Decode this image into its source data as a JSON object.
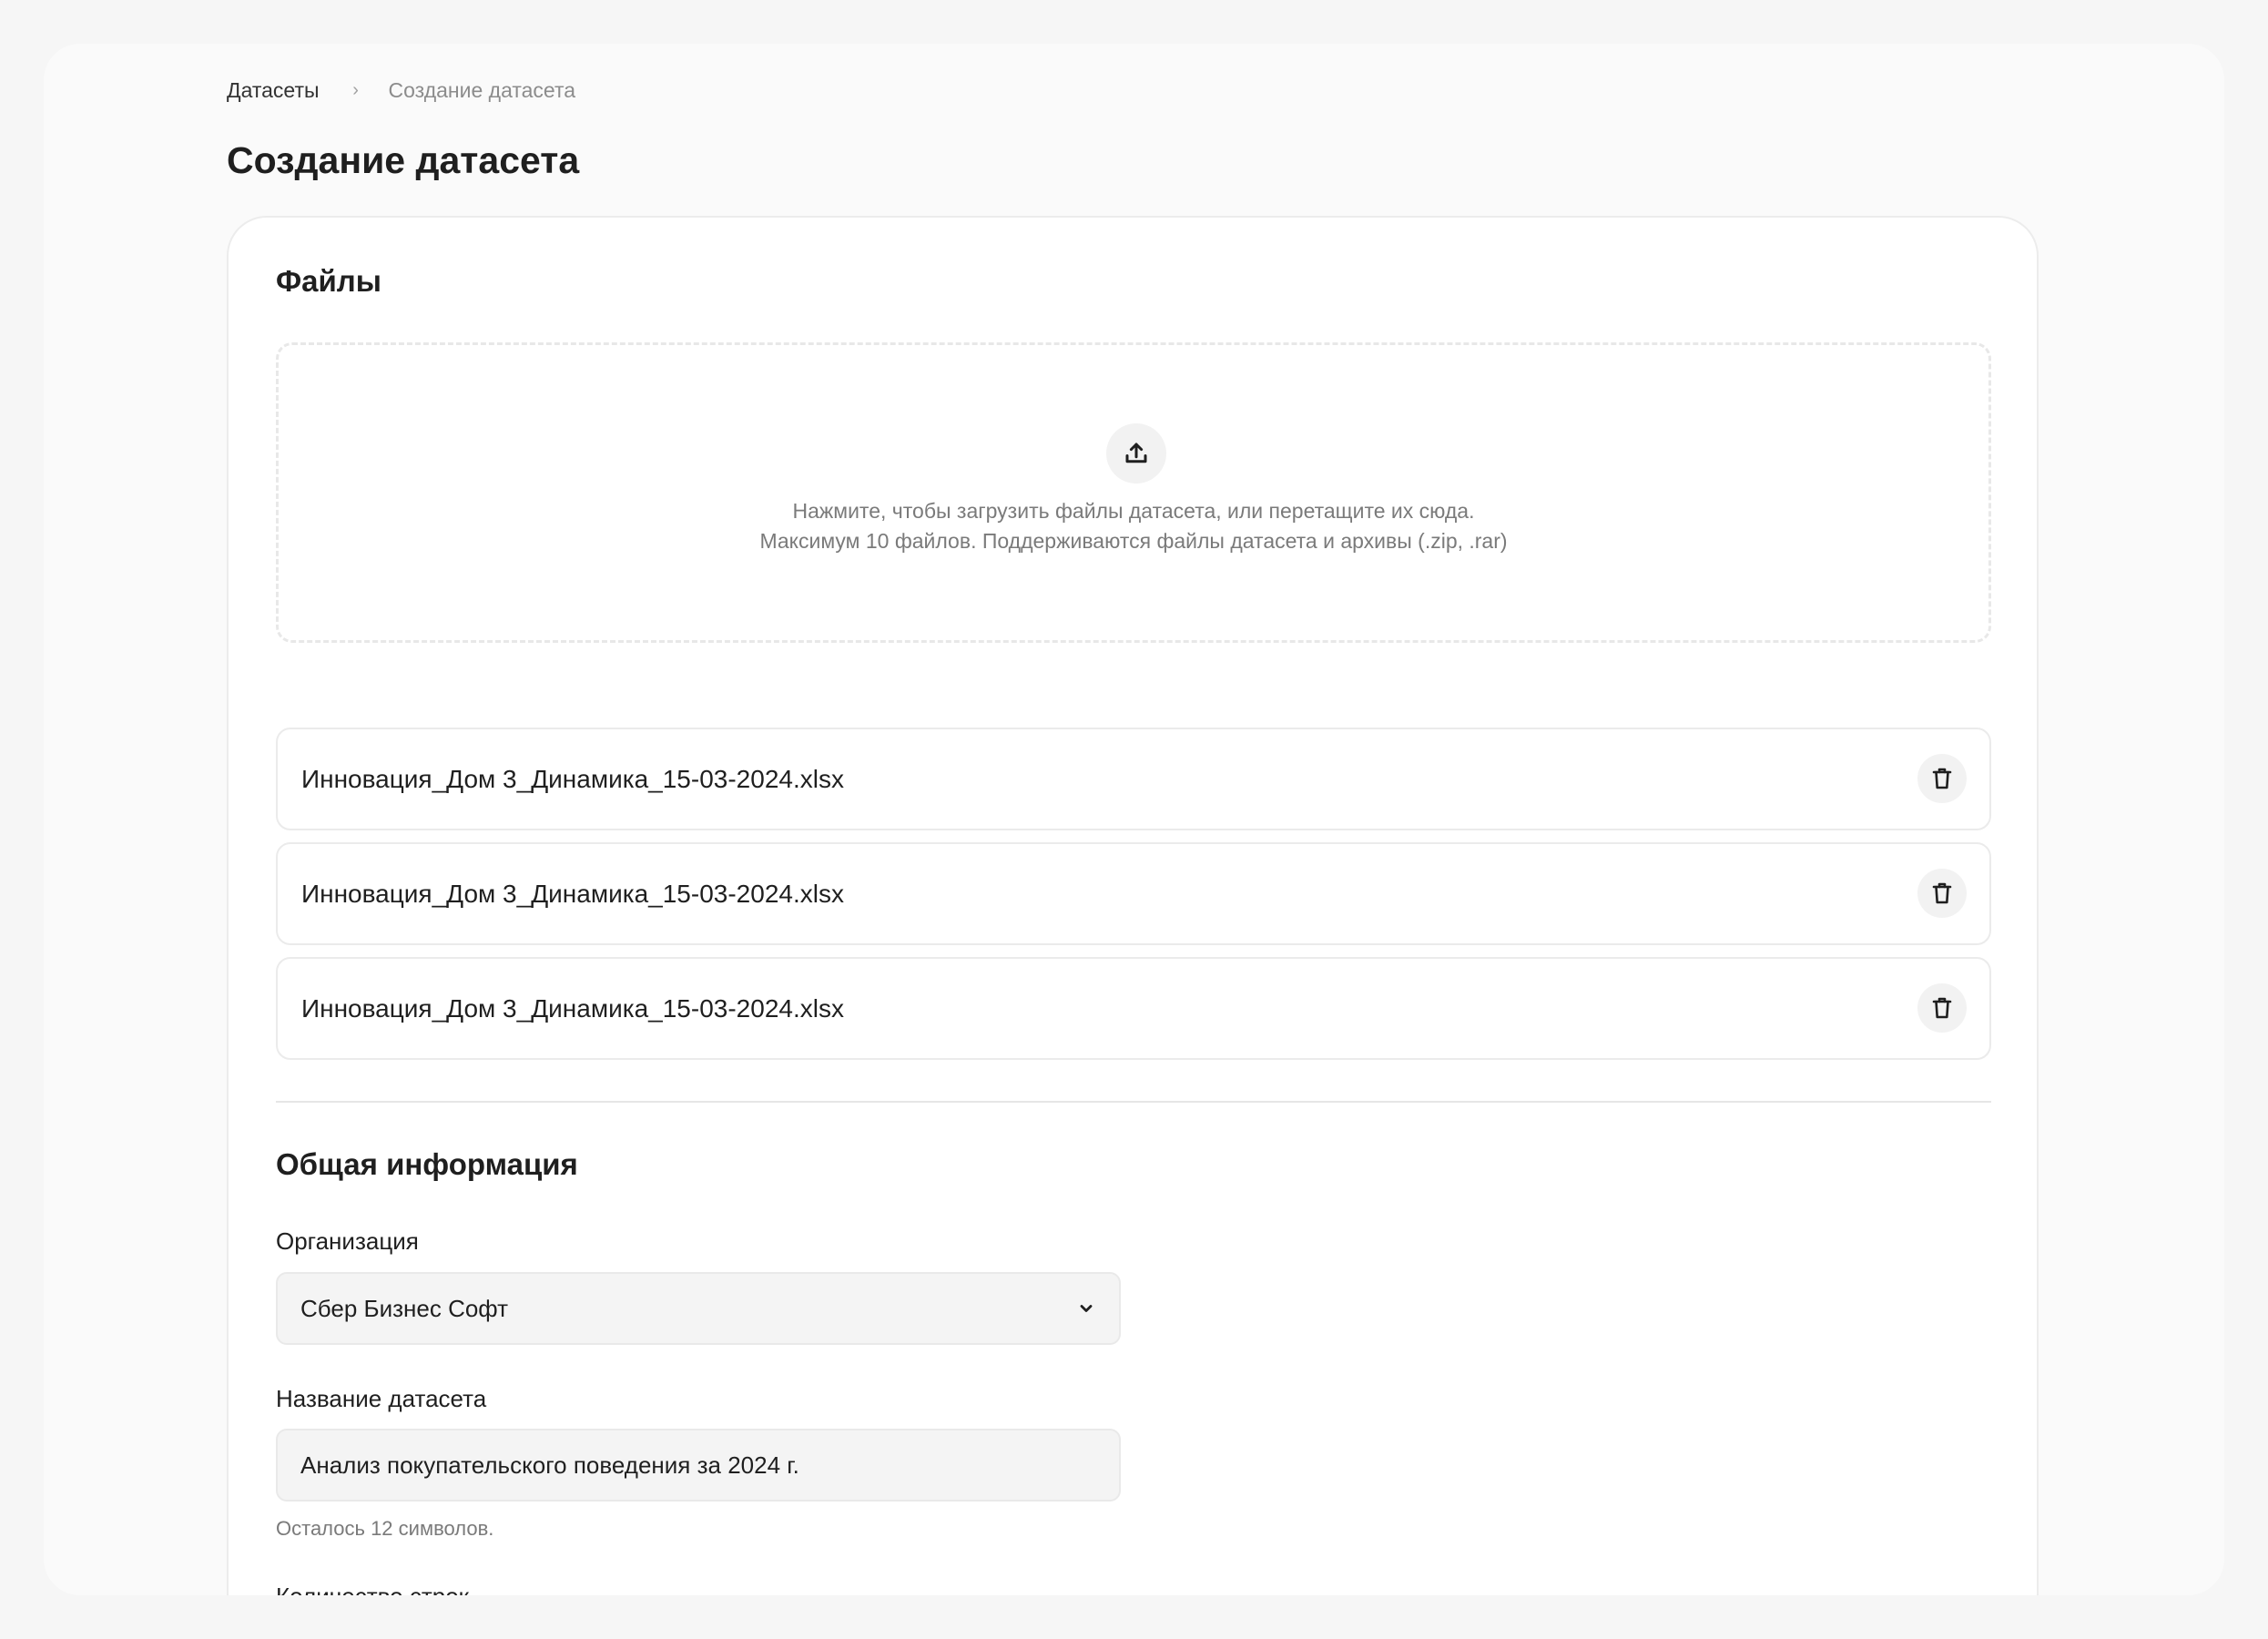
{
  "breadcrumb": {
    "parent": "Датасеты",
    "separator": "›",
    "current": "Создание датасета"
  },
  "page_title": "Создание датасета",
  "files_section": {
    "title": "Файлы",
    "dropzone": {
      "icon": "upload-icon",
      "line1": "Нажмите, чтобы загрузить файлы датасета, или перетащите их сюда.",
      "line2": "Максимум 10 файлов. Поддерживаются файлы датасета и архивы (.zip, .rar)"
    },
    "files": [
      {
        "name": "Инновация_Дом 3_Динамика_15-03-2024.xlsx",
        "action_icon": "trash-icon"
      },
      {
        "name": "Инновация_Дом 3_Динамика_15-03-2024.xlsx",
        "action_icon": "trash-icon"
      },
      {
        "name": "Инновация_Дом 3_Динамика_15-03-2024.xlsx",
        "action_icon": "trash-icon"
      }
    ]
  },
  "general_section": {
    "title": "Общая информация",
    "organization": {
      "label": "Организация",
      "value": "Сбер Бизнес Софт",
      "icon": "chevron-down-icon"
    },
    "dataset_name": {
      "label": "Название датасета",
      "value": "Анализ покупательского поведения за 2024 г.",
      "hint": "Осталось 12 символов."
    },
    "row_count": {
      "label": "Количество строк"
    }
  },
  "colors": {
    "page_bg": "#f6f6f6",
    "card_bg": "#ffffff",
    "input_bg": "#f4f4f4",
    "text_primary": "#1f1f1f",
    "text_secondary": "#7a7a7a"
  }
}
